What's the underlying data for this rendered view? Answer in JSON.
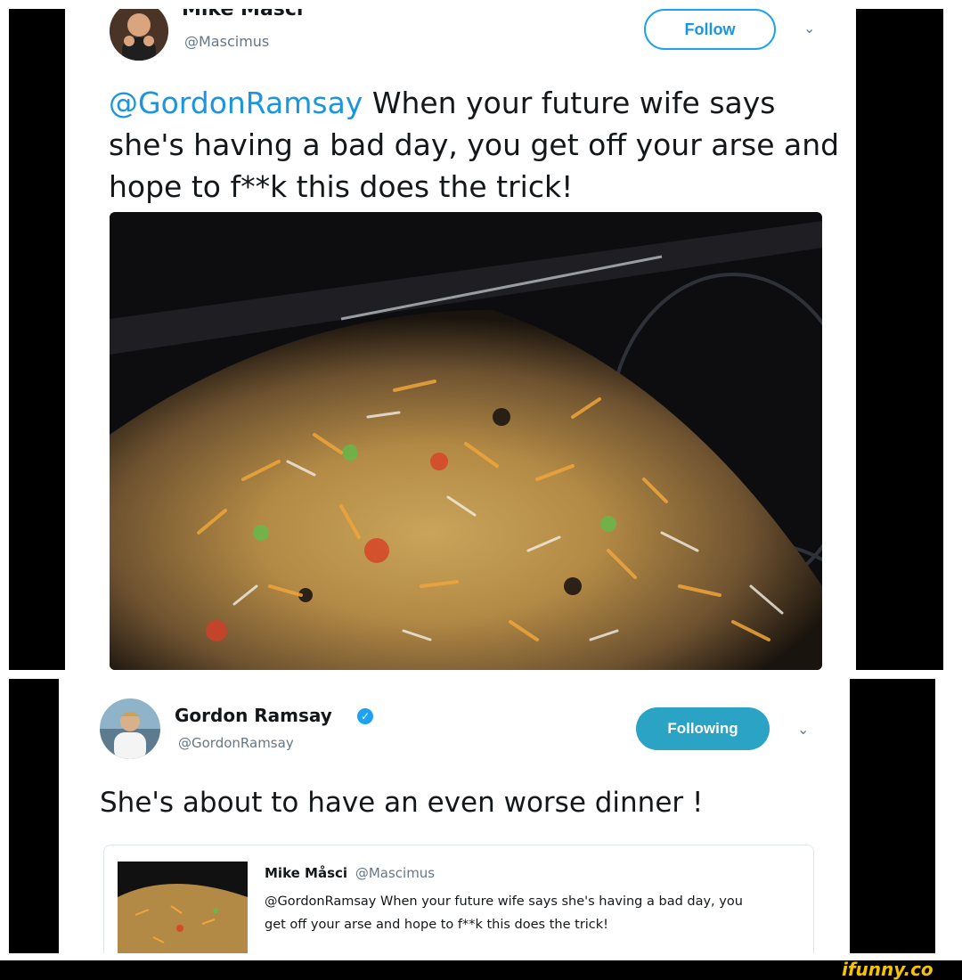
{
  "tweet1": {
    "name": "Mike Masci",
    "handle": "@Mascimus",
    "follow_label": "Follow",
    "text_mention": "@GordonRamsay",
    "text_body": " When your future wife says she's having a bad day, you get off your arse and hope to f**k this does the trick!"
  },
  "tweet2": {
    "name": "Gordon Ramsay",
    "handle": "@GordonRamsay",
    "follow_label": "Following",
    "text": "She's about to have an even worse dinner !",
    "quote": {
      "name": "Mike Måsci",
      "handle": "@Mascimus",
      "text": "@GordonRamsay When your future wife says she's having a bad day, you get off your arse and hope to f**k this does the trick!"
    }
  },
  "watermark": "ifunny.co",
  "colors": {
    "accent": "#1da1f2",
    "following_bg": "#2aa3c4",
    "verified": "#1da1f2",
    "text": "#14171a",
    "muted": "#657786",
    "watermark": "#f5c400"
  },
  "icons": [
    "chevron-down-icon",
    "verified-badge-icon"
  ]
}
